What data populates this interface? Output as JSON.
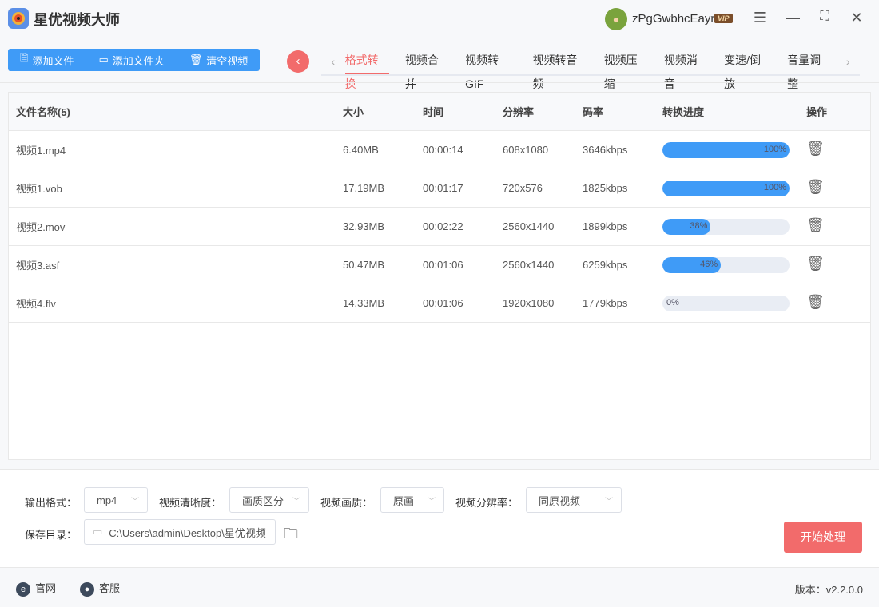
{
  "app": {
    "title": "星优视频大师",
    "username": "zPgGwbhcEayr",
    "vip": "VIP"
  },
  "toolbar": {
    "add_file": "添加文件",
    "add_folder": "添加文件夹",
    "clear": "清空视频"
  },
  "tabs": [
    "格式转换",
    "视频合并",
    "视频转GIF",
    "视频转音频",
    "视频压缩",
    "视频消音",
    "变速/倒放",
    "音量调整"
  ],
  "table": {
    "headers": {
      "name": "文件名称(5)",
      "size": "大小",
      "time": "时间",
      "res": "分辨率",
      "bitrate": "码率",
      "progress": "转换进度",
      "ops": "操作"
    },
    "rows": [
      {
        "name": "视频1.mp4",
        "size": "6.40MB",
        "time": "00:00:14",
        "res": "608x1080",
        "bitrate": "3646kbps",
        "progress": 100,
        "pct": "100%"
      },
      {
        "name": "视频1.vob",
        "size": "17.19MB",
        "time": "00:01:17",
        "res": "720x576",
        "bitrate": "1825kbps",
        "progress": 100,
        "pct": "100%"
      },
      {
        "name": "视频2.mov",
        "size": "32.93MB",
        "time": "00:02:22",
        "res": "2560x1440",
        "bitrate": "1899kbps",
        "progress": 38,
        "pct": "38%"
      },
      {
        "name": "视频3.asf",
        "size": "50.47MB",
        "time": "00:01:06",
        "res": "2560x1440",
        "bitrate": "6259kbps",
        "progress": 46,
        "pct": "46%"
      },
      {
        "name": "视频4.flv",
        "size": "14.33MB",
        "time": "00:01:06",
        "res": "1920x1080",
        "bitrate": "1779kbps",
        "progress": 0,
        "pct": "0%"
      }
    ]
  },
  "settings": {
    "format_label": "输出格式：",
    "format": "mp4",
    "clarity_label": "视频清晰度：",
    "clarity": "画质区分",
    "quality_label": "视频画质：",
    "quality": "原画",
    "resolution_label": "视频分辨率：",
    "resolution": "同原视频",
    "dir_label": "保存目录：",
    "dir": "C:\\Users\\admin\\Desktop\\星优视频",
    "start": "开始处理"
  },
  "footer": {
    "website": "官网",
    "support": "客服",
    "version": "版本：v2.2.0.0"
  },
  "colors": {
    "accent": "#3f9bf7",
    "danger": "#f26b6b"
  }
}
